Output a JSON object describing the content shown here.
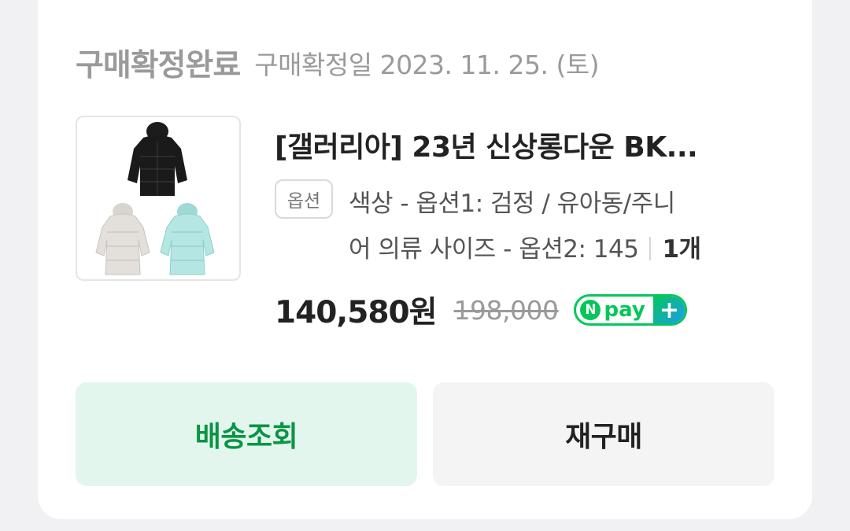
{
  "order": {
    "status_title": "구매확정완료",
    "confirm_date": "구매확정일 2023. 11. 25. (토)"
  },
  "product": {
    "name": "[갤러리아] 23년 신상롱다운 BK...",
    "option_label": "옵션",
    "option_line1": "색상 - 옵션1: 검정 / 유아동/주니",
    "option_line2": "어 의류 사이즈 - 옵션2: 145",
    "quantity": "1개",
    "price": "140,580원",
    "original_price": "198,000",
    "npay_n": "N",
    "npay_text": "pay",
    "npay_plus": "+"
  },
  "actions": {
    "track_label": "배송조회",
    "rebuy_label": "재구매"
  },
  "colors": {
    "accent_green": "#0a9545",
    "track_bg": "#e3f6ed",
    "npay_green": "#03c75a"
  }
}
